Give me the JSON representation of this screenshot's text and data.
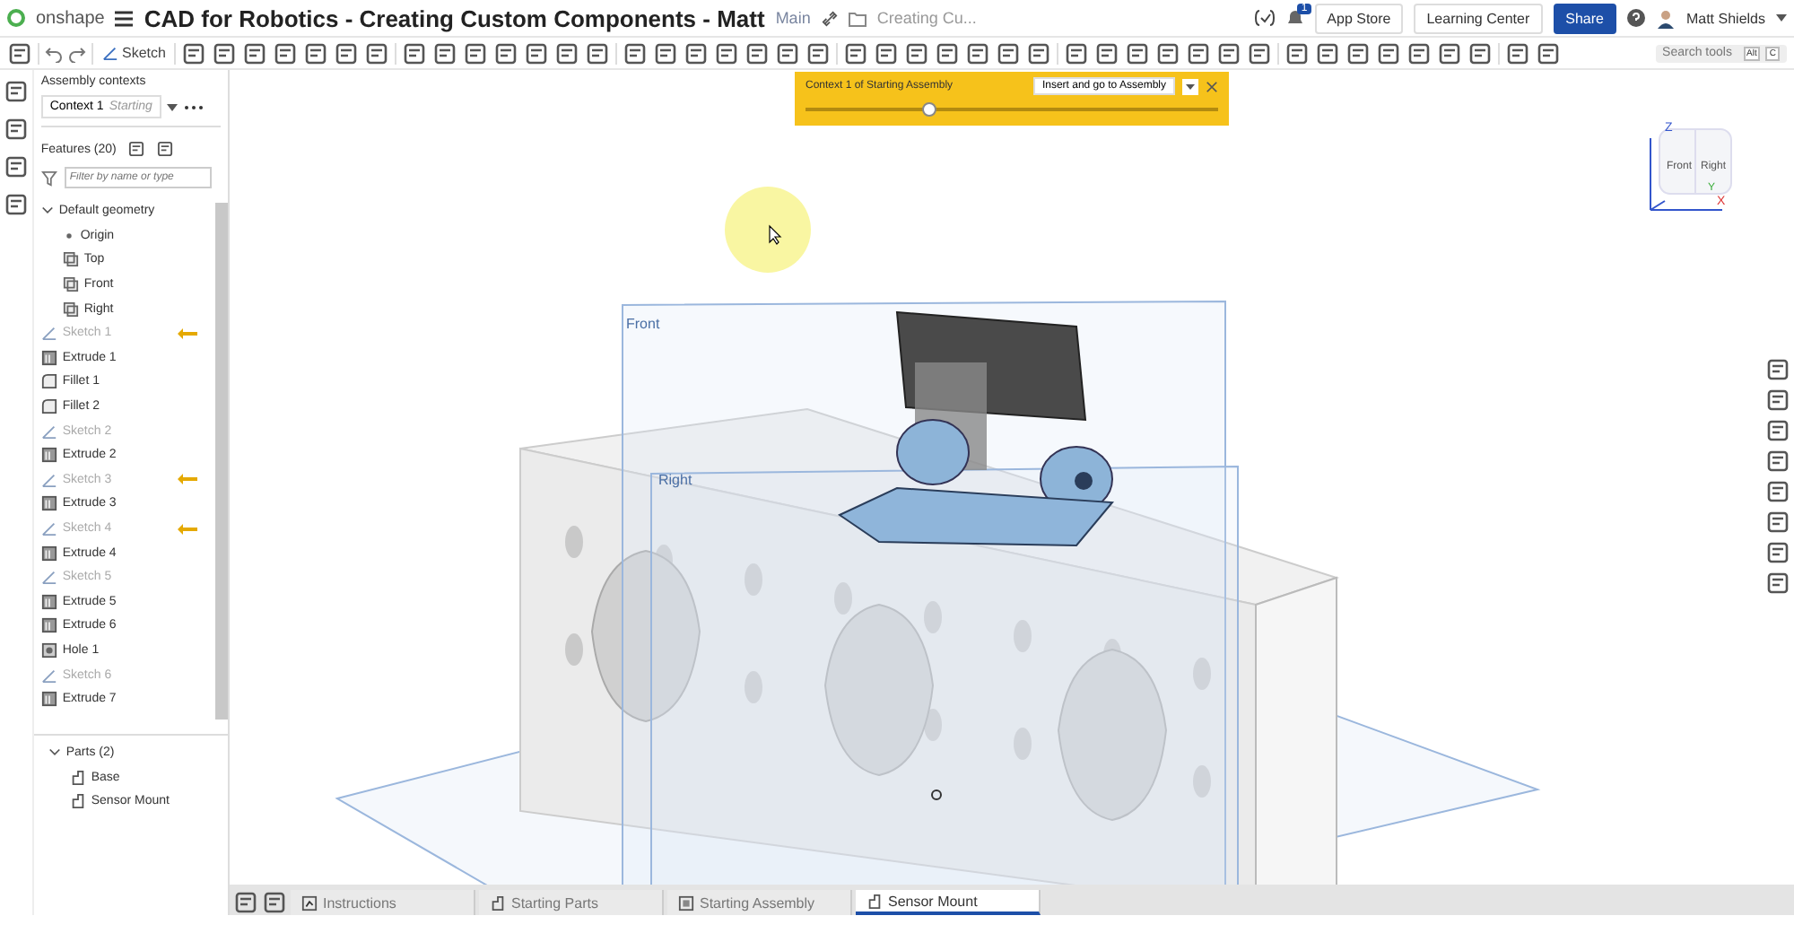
{
  "header": {
    "logo": "onshape",
    "title": "CAD for Robotics - Creating Custom Components - Matt",
    "branch": "Main",
    "folder": "Creating Cu...",
    "notifications": "1",
    "buttons": [
      {
        "label": "App Store",
        "kind": "plain"
      },
      {
        "label": "Learning Center",
        "kind": "plain"
      },
      {
        "label": "Share",
        "kind": "primary"
      }
    ],
    "user": "Matt Shields"
  },
  "toolbar": {
    "sketch": "Sketch",
    "search": {
      "placeholder": "Search tools",
      "keys": [
        "Alt",
        "C"
      ]
    }
  },
  "contexts": {
    "title": "Assembly contexts",
    "context": "Context 1",
    "context_detail": "Starting"
  },
  "features": {
    "title": "Features (20)",
    "filter": {
      "placeholder": "Filter by name or type"
    },
    "default_geometry": {
      "label": "Default geometry",
      "expanded": true,
      "children": [
        {
          "label": "Origin",
          "kind": "point"
        },
        {
          "label": "Top",
          "kind": "plane"
        },
        {
          "label": "Front",
          "kind": "plane"
        },
        {
          "label": "Right",
          "kind": "plane"
        }
      ]
    },
    "items": [
      {
        "label": "Sketch 1",
        "kind": "sketch",
        "hidden": true,
        "flagged": true
      },
      {
        "label": "Extrude 1",
        "kind": "extrude",
        "hidden": false,
        "flagged": false
      },
      {
        "label": "Fillet 1",
        "kind": "fillet",
        "hidden": false,
        "flagged": false
      },
      {
        "label": "Fillet 2",
        "kind": "fillet",
        "hidden": false,
        "flagged": false
      },
      {
        "label": "Sketch 2",
        "kind": "sketch",
        "hidden": true,
        "flagged": false
      },
      {
        "label": "Extrude 2",
        "kind": "extrude",
        "hidden": false,
        "flagged": false
      },
      {
        "label": "Sketch 3",
        "kind": "sketch",
        "hidden": true,
        "flagged": true
      },
      {
        "label": "Extrude 3",
        "kind": "extrude",
        "hidden": false,
        "flagged": false
      },
      {
        "label": "Sketch 4",
        "kind": "sketch",
        "hidden": true,
        "flagged": true
      },
      {
        "label": "Extrude 4",
        "kind": "extrude",
        "hidden": false,
        "flagged": false
      },
      {
        "label": "Sketch 5",
        "kind": "sketch",
        "hidden": true,
        "flagged": false
      },
      {
        "label": "Extrude 5",
        "kind": "extrude",
        "hidden": false,
        "flagged": false
      },
      {
        "label": "Extrude 6",
        "kind": "extrude",
        "hidden": false,
        "flagged": false
      },
      {
        "label": "Hole 1",
        "kind": "hole",
        "hidden": false,
        "flagged": false
      },
      {
        "label": "Sketch 6",
        "kind": "sketch",
        "hidden": true,
        "flagged": false
      },
      {
        "label": "Extrude 7",
        "kind": "extrude",
        "hidden": false,
        "flagged": false
      }
    ]
  },
  "parts": {
    "label": "Parts (2)",
    "expanded": true,
    "items": [
      "Base",
      "Sensor Mount"
    ]
  },
  "context_banner": {
    "label": "Context 1 of Starting Assembly",
    "action": "Insert and go to Assembly",
    "level": 0.3
  },
  "viewport": {
    "planes": [
      "Front",
      "Right"
    ],
    "view_cube": {
      "faces": [
        "Front",
        "Right"
      ],
      "axes": [
        "Z",
        "Y",
        "X"
      ]
    }
  },
  "tabs": [
    {
      "label": "Instructions",
      "kind": "document",
      "selected": false
    },
    {
      "label": "Starting Parts",
      "kind": "part",
      "selected": false
    },
    {
      "label": "Starting Assembly",
      "kind": "assembly",
      "selected": false
    },
    {
      "label": "Sensor Mount",
      "kind": "part",
      "selected": true
    }
  ]
}
